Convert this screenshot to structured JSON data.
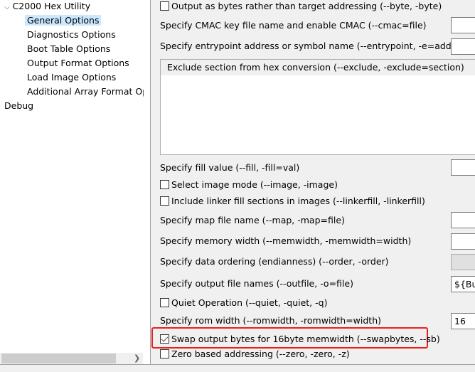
{
  "tree": {
    "parent": "C2000 Hex Utility",
    "children": [
      "General Options",
      "Diagnostics Options",
      "Boot Table Options",
      "Output Format Options",
      "Load Image Options",
      "Additional Array Format Opt"
    ],
    "selected": "General Options",
    "sibling": "Debug"
  },
  "options": {
    "byte": {
      "label": "Output as bytes rather than target addressing (--byte, -byte)",
      "checked": false
    },
    "cmac": {
      "label": "Specify CMAC key file name and enable CMAC (--cmac=file)",
      "value": ""
    },
    "entrypoint": {
      "label": "Specify entrypoint address or symbol name (--entrypoint, -e=addr)",
      "value": ""
    },
    "exclude": {
      "label": "Exclude section from hex conversion (--exclude, -exclude=section)"
    },
    "fill": {
      "label": "Specify fill value (--fill, -fill=val)",
      "value": ""
    },
    "image": {
      "label": "Select image mode (--image, -image)",
      "checked": false
    },
    "linkerfill": {
      "label": "Include linker fill sections in images (--linkerfill, -linkerfill)",
      "checked": false
    },
    "map": {
      "label": "Specify map file name (--map, -map=file)",
      "value": ""
    },
    "memwidth": {
      "label": "Specify memory width (--memwidth, -memwidth=width)",
      "value": ""
    },
    "order": {
      "label": "Specify data ordering (endianness) (--order, -order)",
      "value": ""
    },
    "outfile": {
      "label": "Specify output file names (--outfile, -o=file)",
      "value": "${BuildArtifactFileBaseName}"
    },
    "quiet": {
      "label": "Quiet Operation (--quiet, -quiet, -q)",
      "checked": false
    },
    "romwidth": {
      "label": "Specify rom width (--romwidth, -romwidth=width)",
      "value": "16"
    },
    "swapbytes": {
      "label": "Swap output bytes for 16byte memwidth (--swapbytes, --sb)",
      "checked": true
    },
    "zero": {
      "label": "Zero based addressing (--zero, -zero, -z)",
      "checked": false
    }
  },
  "highlight_color": "#e8211b"
}
